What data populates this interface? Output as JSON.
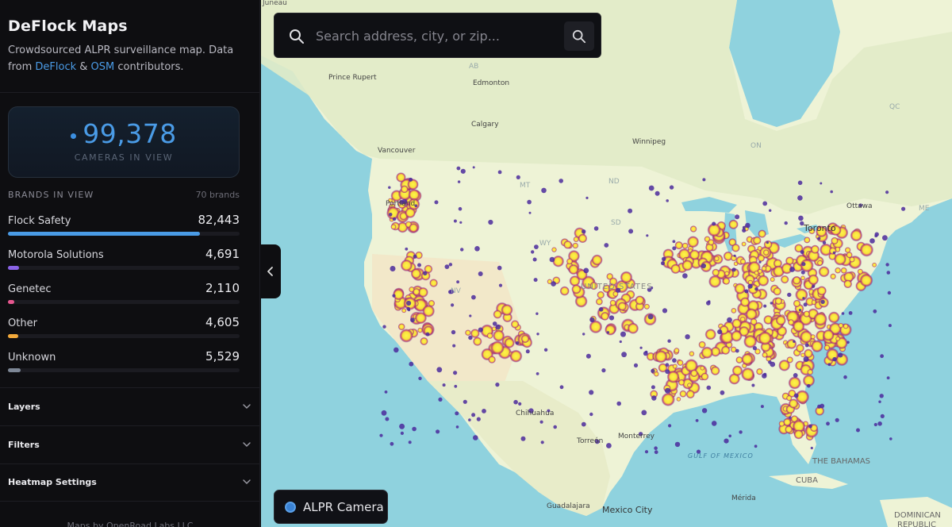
{
  "app": {
    "title": "DeFlock Maps",
    "description_prefix": "Crowdsourced ALPR surveillance map. Data from ",
    "link1": "DeFlock",
    "description_and": " & ",
    "link2": "OSM",
    "description_suffix": " contributors."
  },
  "summary": {
    "count": "99,378",
    "count_label": "CAMERAS IN VIEW"
  },
  "brands": {
    "heading": "BRANDS IN VIEW",
    "total": "70 brands",
    "items": [
      {
        "name": "Flock Safety",
        "value": "82,443",
        "fraction": 0.83,
        "color": "#4a9be6"
      },
      {
        "name": "Motorola Solutions",
        "value": "4,691",
        "fraction": 0.047,
        "color": "#8a63e6"
      },
      {
        "name": "Genetec",
        "value": "2,110",
        "fraction": 0.021,
        "color": "#e6578f"
      },
      {
        "name": "Other",
        "value": "4,605",
        "fraction": 0.046,
        "color": "#f2a93b"
      },
      {
        "name": "Unknown",
        "value": "5,529",
        "fraction": 0.056,
        "color": "#7d8796"
      }
    ]
  },
  "sections": [
    {
      "label": "Layers"
    },
    {
      "label": "Filters"
    },
    {
      "label": "Heatmap Settings"
    }
  ],
  "footer": "Maps by OpenRoad Labs LLC",
  "search": {
    "placeholder": "Search address, city, or zip...",
    "value": ""
  },
  "legend": {
    "label": "ALPR Camera",
    "color": "#3a82d4"
  },
  "map_labels": {
    "juneau": "Juneau",
    "ab": "AB",
    "prince_rupert": "Prince Rupert",
    "edmonton": "Edmonton",
    "calgary": "Calgary",
    "vancouver": "Vancouver",
    "winnipeg": "Winnipeg",
    "on": "ON",
    "qc": "QC",
    "mt": "MT",
    "nd": "ND",
    "sd": "SD",
    "wy": "WY",
    "nv": "NV",
    "portland": "Portland",
    "united_states": "UNITED STATES",
    "toronto": "Toronto",
    "ottawa": "Ottawa",
    "me": "ME",
    "chihuahua": "Chihuahua",
    "torreon": "Torreón",
    "monterrey": "Monterrey",
    "gulf": "GULF OF MEXICO",
    "bahamas": "THE BAHAMAS",
    "cuba": "CUBA",
    "guadalajara": "Guadalajara",
    "mexico_city": "Mexico City",
    "merida": "Mérida",
    "dominican": "DOMINICAN",
    "republic": "REPUBLIC"
  }
}
